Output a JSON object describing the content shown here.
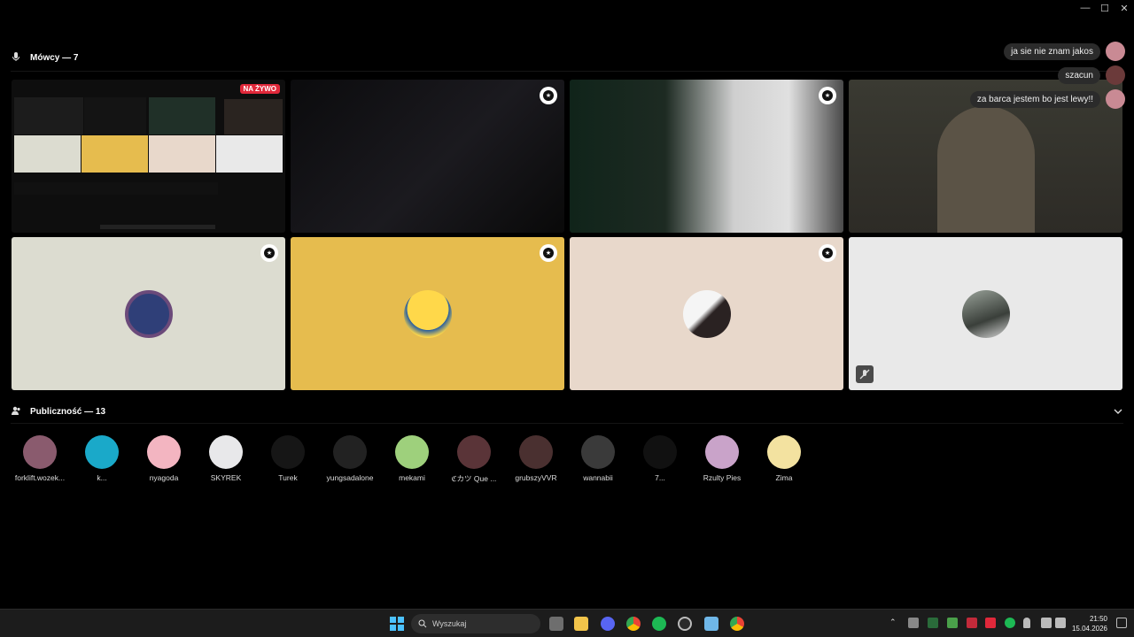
{
  "window": {
    "minimize": "—",
    "maximize": "☐",
    "close": "✕"
  },
  "speakers": {
    "title": "Mówcy — 7"
  },
  "live_label": "NA ŻYWO",
  "chat": [
    {
      "text": "ja sie nie znam jakos"
    },
    {
      "text": "szacun"
    },
    {
      "text": "za barca jestem bo jest lewy!!"
    }
  ],
  "audience": {
    "title": "Publiczność — 13",
    "members": [
      {
        "name": "forklift.wozek...",
        "color": "#8a5b6e"
      },
      {
        "name": "k...",
        "color": "#1aa9c9"
      },
      {
        "name": "nyagoda",
        "color": "#f3b5c1"
      },
      {
        "name": "SKYREK",
        "color": "#e8e8ea"
      },
      {
        "name": "Turek",
        "color": "#161616"
      },
      {
        "name": "yungsadalone",
        "color": "#222"
      },
      {
        "name": "mekami",
        "color": "#9ed07c"
      },
      {
        "name": "ℭカツ Que ...",
        "color": "#5a3438"
      },
      {
        "name": "grubszyVVR",
        "color": "#4a3030"
      },
      {
        "name": "wannabii",
        "color": "#3a3a3a"
      },
      {
        "name": "7...",
        "color": "#111"
      },
      {
        "name": "Rzulty Pies",
        "color": "#c9a3c9"
      },
      {
        "name": "Zima",
        "color": "#f3e2a0"
      }
    ]
  },
  "taskbar": {
    "search_placeholder": "Wyszukaj",
    "time": "21:50",
    "date": "15.04.2026"
  },
  "colors": {
    "tile_sage": "#dcdcd0",
    "tile_yellow": "#e6bc4e",
    "tile_beige": "#e8d8cb",
    "tile_light": "#e9e9e9",
    "live_red": "#e0283a"
  }
}
